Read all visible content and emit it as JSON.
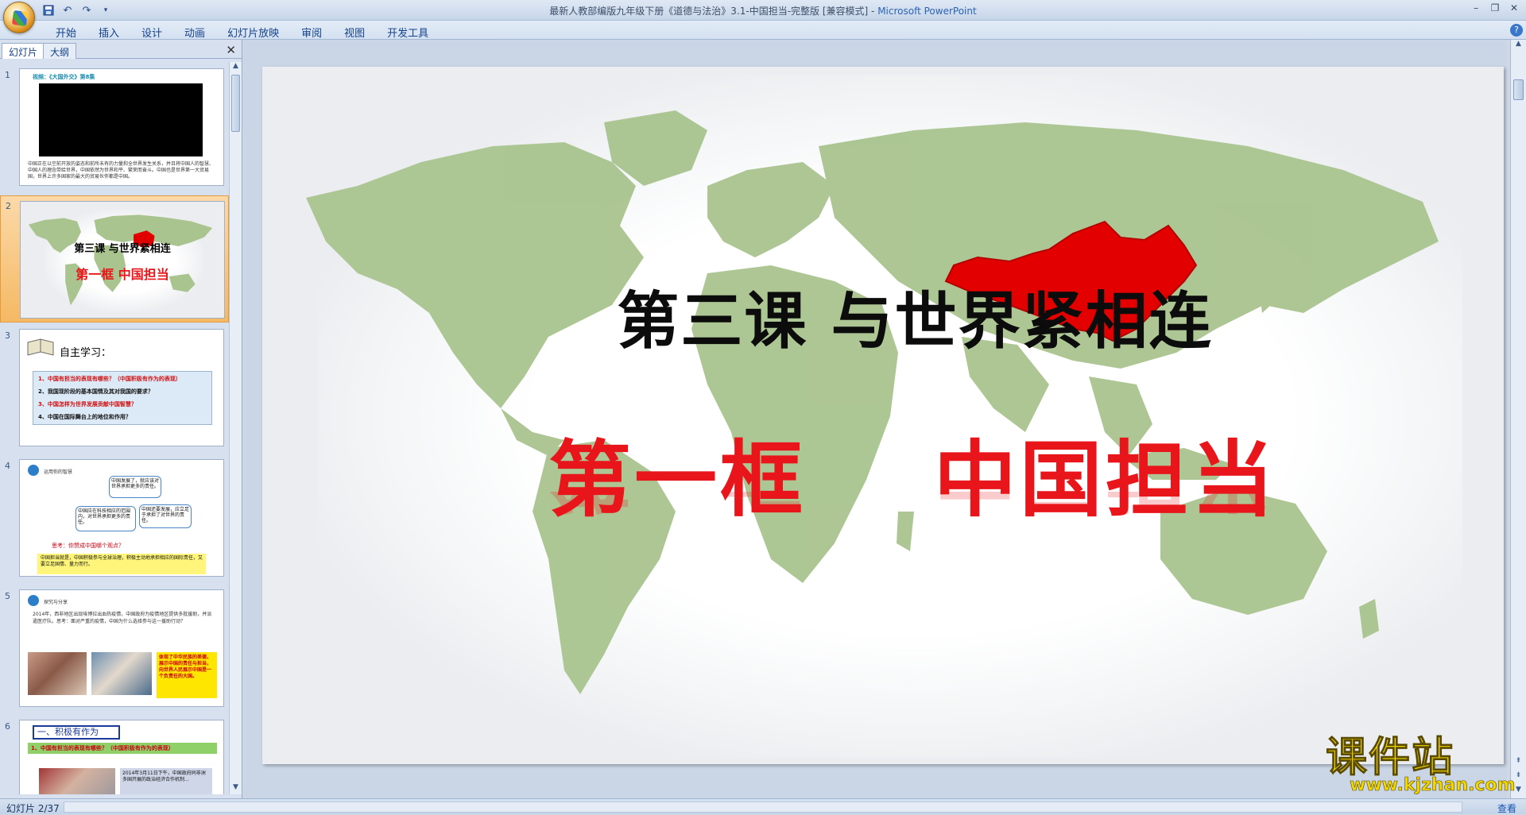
{
  "window": {
    "title": "最新人教部编版九年级下册《道德与法治》3.1-中国担当-完整版 [兼容模式] - ",
    "app_name": "Microsoft PowerPoint"
  },
  "ribbon": {
    "tabs": [
      "开始",
      "插入",
      "设计",
      "动画",
      "幻灯片放映",
      "审阅",
      "视图",
      "开发工具"
    ]
  },
  "left_pane": {
    "tabs": [
      "幻灯片",
      "大纲"
    ],
    "active_tab": "幻灯片",
    "slides": [
      {
        "num": "1",
        "title": "视频：《大国外交》第8集",
        "text": "中国正在以空前开放的姿态和前所未有的力量和全世界发生关系，并且将中国人的智慧、中国人的理念带给世界，中国依然为世界和平、繁荣而奋斗。中国也是世界第一大贸易国，世界上许多国家的最大的贸易伙伴都是中国。"
      },
      {
        "num": "2",
        "title": "第三课 与世界紧相连",
        "subtitle": "第一框    中国担当"
      },
      {
        "num": "3",
        "heading": "自主学习：",
        "items": [
          "1、中国有担当的表现有哪些？（中国积极有作为的表现）",
          "2、我国现阶段的基本国情及其对我国的要求？",
          "3、中国怎样为世界发展贡献中国智慧？",
          "4、中国在国际舞台上的地位和作用？"
        ]
      },
      {
        "num": "4",
        "label": "运用你的智慧",
        "bubbles": [
          "中国发展了，就应该对世界承担更多的责任。",
          "中国应在科技相应的范围内，对世界承担更多的责任。",
          "中国还要发展，应立足于承担了对世界的责任。"
        ],
        "ask": "思考：你赞成中国哪个观点？",
        "conclusion": "中国担当就是，中国积极参与全球治理，积极主动地承担相应的国际责任，又要立足国情、量力而行。"
      },
      {
        "num": "5",
        "label": "探究与分享",
        "text": "2014年，西非地区出现埃博拉出血热疫情，中国政府为疫情地区提供多批援助，并派遣医疗队。思考：面对严重的疫情，中国为什么选择参与这一援助行动？",
        "highlight": "体现了中华民族的美德，展示中国的责任与担当，向世界人民展示中国是一个负责任的大国。"
      },
      {
        "num": "6",
        "heading": "一、积极有作为",
        "bar": "1、中国有担当的表现有哪些？（中国积极有作为的表现）",
        "text": "2014年3月11日下午，中国政府同非洲多国开展的政治经济合作机制..."
      }
    ]
  },
  "slide": {
    "title": "第三课 与世界紧相连",
    "subtitle": "第一框    中国担当"
  },
  "watermark": {
    "big": "课件站",
    "url": "www.kjzhan.com"
  },
  "status": {
    "slide_info": "幻灯片 2/37",
    "right": "查看"
  },
  "colors": {
    "accent_red": "#e8161b",
    "land": "#a9c48e",
    "china": "#e00000",
    "ribbon_text": "#15428b"
  }
}
